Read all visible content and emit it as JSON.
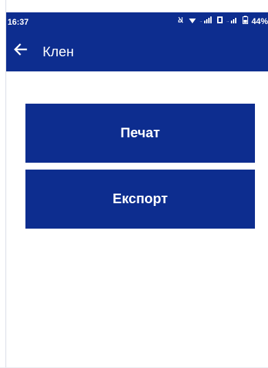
{
  "status_bar": {
    "time": "16:37",
    "battery": "44%",
    "icons": [
      "mute-icon",
      "wifi-icon",
      "signal-icon",
      "data-icon",
      "signal-icon-2",
      "battery-icon"
    ]
  },
  "app_bar": {
    "title": "Клен",
    "back_icon": "arrow-left-icon"
  },
  "actions": {
    "print_label": "Печат",
    "export_label": "Експорт"
  },
  "colors": {
    "primary": "#0d2d8f",
    "text_on_primary": "#ffffff",
    "background": "#ffffff"
  }
}
